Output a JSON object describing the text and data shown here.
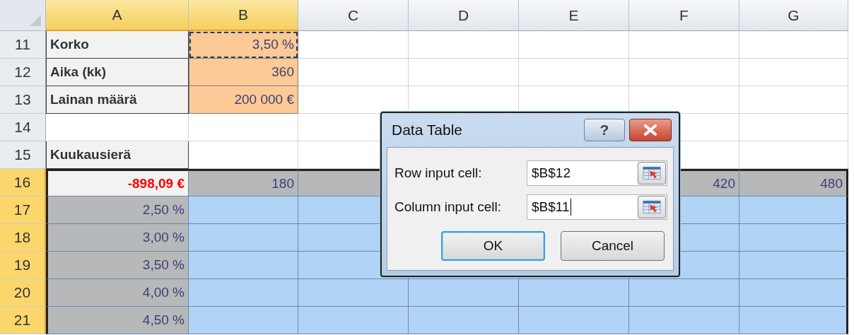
{
  "sheet": {
    "columns": [
      {
        "label": "A",
        "selected": true
      },
      {
        "label": "B",
        "selected": true
      },
      {
        "label": "C",
        "selected": false
      },
      {
        "label": "D",
        "selected": false
      },
      {
        "label": "E",
        "selected": false
      },
      {
        "label": "F",
        "selected": false
      },
      {
        "label": "G",
        "selected": false
      }
    ],
    "rows": [
      {
        "number": "11",
        "selected": false,
        "cells": [
          {
            "kind": "label",
            "text": "Korko"
          },
          {
            "kind": "input",
            "text": "3,50 %",
            "marquee": true
          },
          {
            "kind": "blank"
          },
          {
            "kind": "blank"
          },
          {
            "kind": "blank"
          },
          {
            "kind": "blank"
          },
          {
            "kind": "blank"
          }
        ]
      },
      {
        "number": "12",
        "selected": false,
        "cells": [
          {
            "kind": "label",
            "text": "Aika (kk)"
          },
          {
            "kind": "input",
            "text": "360"
          },
          {
            "kind": "blank"
          },
          {
            "kind": "blank"
          },
          {
            "kind": "blank"
          },
          {
            "kind": "blank"
          },
          {
            "kind": "blank"
          }
        ]
      },
      {
        "number": "13",
        "selected": false,
        "cells": [
          {
            "kind": "label",
            "text": "Lainan määrä"
          },
          {
            "kind": "input",
            "text": "200 000 €"
          },
          {
            "kind": "blank"
          },
          {
            "kind": "blank"
          },
          {
            "kind": "blank"
          },
          {
            "kind": "blank"
          },
          {
            "kind": "blank"
          }
        ]
      },
      {
        "number": "14",
        "selected": false,
        "cells": [
          {
            "kind": "blank"
          },
          {
            "kind": "blank"
          },
          {
            "kind": "blank"
          },
          {
            "kind": "covered"
          },
          {
            "kind": "covered"
          },
          {
            "kind": "blank"
          },
          {
            "kind": "blank"
          }
        ]
      },
      {
        "number": "15",
        "selected": false,
        "cells": [
          {
            "kind": "label",
            "text": "Kuukausierä"
          },
          {
            "kind": "blank"
          },
          {
            "kind": "blank"
          },
          {
            "kind": "covered"
          },
          {
            "kind": "covered"
          },
          {
            "kind": "blank"
          },
          {
            "kind": "blank"
          }
        ]
      },
      {
        "number": "16",
        "selected": true,
        "cells": [
          {
            "kind": "result",
            "text": "-898,09 €"
          },
          {
            "kind": "term",
            "text": "180"
          },
          {
            "kind": "term"
          },
          {
            "kind": "term"
          },
          {
            "kind": "term"
          },
          {
            "kind": "term",
            "text": "420"
          },
          {
            "kind": "term",
            "text": "480"
          }
        ]
      },
      {
        "number": "17",
        "selected": true,
        "cells": [
          {
            "kind": "rate",
            "text": "2,50 %"
          },
          {
            "kind": "body"
          },
          {
            "kind": "body"
          },
          {
            "kind": "body"
          },
          {
            "kind": "body"
          },
          {
            "kind": "body"
          },
          {
            "kind": "body"
          }
        ]
      },
      {
        "number": "18",
        "selected": true,
        "cells": [
          {
            "kind": "rate",
            "text": "3,00 %"
          },
          {
            "kind": "body"
          },
          {
            "kind": "body"
          },
          {
            "kind": "body"
          },
          {
            "kind": "body"
          },
          {
            "kind": "body"
          },
          {
            "kind": "body"
          }
        ]
      },
      {
        "number": "19",
        "selected": true,
        "cells": [
          {
            "kind": "rate",
            "text": "3,50 %"
          },
          {
            "kind": "body"
          },
          {
            "kind": "body"
          },
          {
            "kind": "body"
          },
          {
            "kind": "body"
          },
          {
            "kind": "body"
          },
          {
            "kind": "body"
          }
        ]
      },
      {
        "number": "20",
        "selected": true,
        "cells": [
          {
            "kind": "rate",
            "text": "4,00 %"
          },
          {
            "kind": "body"
          },
          {
            "kind": "body"
          },
          {
            "kind": "body"
          },
          {
            "kind": "body"
          },
          {
            "kind": "body"
          },
          {
            "kind": "body"
          }
        ]
      },
      {
        "number": "21",
        "selected": true,
        "cells": [
          {
            "kind": "rate",
            "text": "4,50 %"
          },
          {
            "kind": "body"
          },
          {
            "kind": "body"
          },
          {
            "kind": "body"
          },
          {
            "kind": "body"
          },
          {
            "kind": "body"
          },
          {
            "kind": "body"
          }
        ]
      }
    ]
  },
  "dialog": {
    "title": "Data Table",
    "help_button": "?",
    "fields": [
      {
        "label": "Row input cell:",
        "value": "$B$12",
        "focused": false
      },
      {
        "label": "Column input cell:",
        "value": "$B$11",
        "focused": true
      }
    ],
    "buttons": [
      {
        "label": "OK",
        "default": true
      },
      {
        "label": "Cancel",
        "default": false
      }
    ]
  }
}
